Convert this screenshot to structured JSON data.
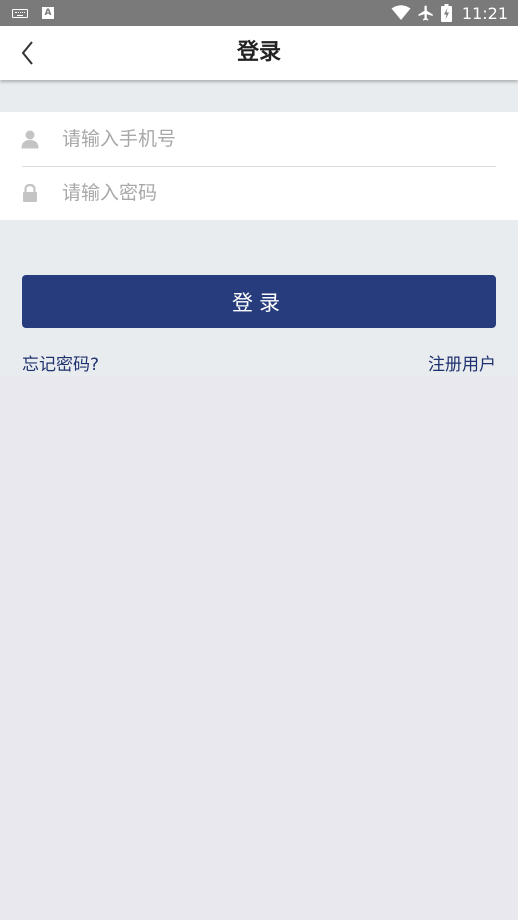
{
  "status_bar": {
    "time": "11:21",
    "icons": [
      "keyboard-icon",
      "a-icon",
      "wifi-icon",
      "airplane-icon",
      "battery-icon"
    ]
  },
  "header": {
    "title": "登录",
    "back_icon": "chevron-left-icon"
  },
  "form": {
    "phone": {
      "placeholder": "请输入手机号",
      "value": "",
      "icon": "user-icon"
    },
    "password": {
      "placeholder": "请输入密码",
      "value": "",
      "icon": "lock-icon"
    }
  },
  "actions": {
    "login_label": "登录",
    "forgot_label": "忘记密码?",
    "register_label": "注册用户"
  },
  "colors": {
    "primary": "#263c7c",
    "link": "#1f3270",
    "status_bar": "#7a7a7a",
    "background": "#e8e8ee",
    "panel": "#e9ecee"
  }
}
